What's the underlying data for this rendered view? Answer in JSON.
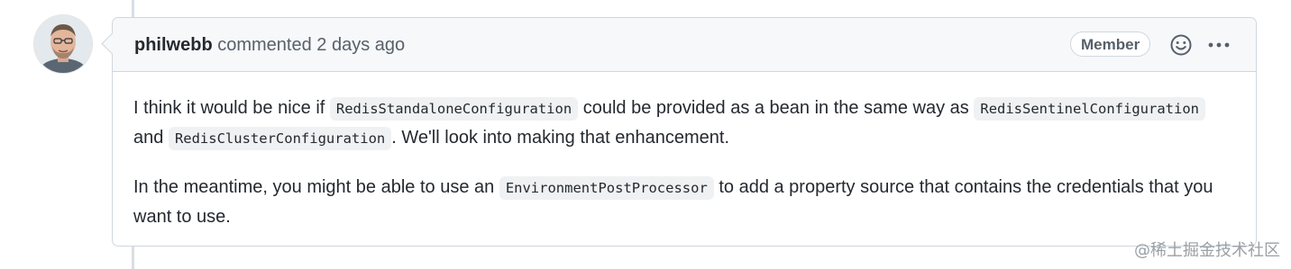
{
  "comment": {
    "author": "philwebb",
    "action": "commented",
    "time": "2 days ago",
    "role_badge": "Member",
    "paragraph1": {
      "t1": "I think it would be nice if ",
      "c1": "RedisStandaloneConfiguration",
      "t2": " could be provided as a bean in the same way as ",
      "c2": "RedisSentinelConfiguration",
      "t3": " and ",
      "c3": "RedisClusterConfiguration",
      "t4": ". We'll look into making that enhancement."
    },
    "paragraph2": {
      "t1": "In the meantime, you might be able to use an ",
      "c1": "EnvironmentPostProcessor",
      "t2": " to add a property source that contains the credentials that you want to use."
    }
  },
  "icons": {
    "emoji": "smiley-icon",
    "more": "kebab-horizontal-icon"
  },
  "watermark": "@稀土掘金技术社区",
  "colors": {
    "header_bg": "#f6f8fa",
    "border": "#d0d7de",
    "muted_text": "#57606a",
    "code_bg": "#eff1f3"
  }
}
